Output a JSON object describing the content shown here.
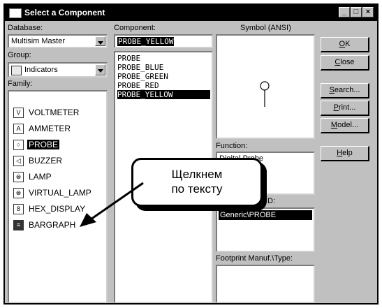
{
  "window": {
    "title": "Select a Component",
    "controls": [
      "_",
      "□",
      "×"
    ]
  },
  "database": {
    "label": "Database:",
    "value": "Multisim Master"
  },
  "group": {
    "label": "Group:",
    "value": "Indicators"
  },
  "family": {
    "label": "Family:",
    "items": [
      {
        "label": "VOLTMETER",
        "icon": "voltmeter-icon",
        "selected": false
      },
      {
        "label": "AMMETER",
        "icon": "ammeter-icon",
        "selected": false
      },
      {
        "label": "PROBE",
        "icon": "probe-icon",
        "selected": true
      },
      {
        "label": "BUZZER",
        "icon": "buzzer-icon",
        "selected": false
      },
      {
        "label": "LAMP",
        "icon": "lamp-icon",
        "selected": false
      },
      {
        "label": "VIRTUAL_LAMP",
        "icon": "virtual-lamp-icon",
        "selected": false
      },
      {
        "label": "HEX_DISPLAY",
        "icon": "hex-display-icon",
        "selected": false
      },
      {
        "label": "BARGRAPH",
        "icon": "bargraph-icon",
        "selected": false
      }
    ]
  },
  "component": {
    "label": "Component:",
    "value": "PROBE_YELLOW",
    "items": [
      {
        "label": "PROBE",
        "selected": false
      },
      {
        "label": "PROBE_BLUE",
        "selected": false
      },
      {
        "label": "PROBE_GREEN",
        "selected": false
      },
      {
        "label": "PROBE_RED",
        "selected": false
      },
      {
        "label": "PROBE_YELLOW",
        "selected": true
      }
    ]
  },
  "symbol": {
    "label": "Symbol (ANSI)"
  },
  "function": {
    "label": "Function:",
    "value": "Digital Probe"
  },
  "model_manuf": {
    "label_suffix": "D:",
    "value": "Generic\\PROBE"
  },
  "footprint": {
    "label": "Footprint Manuf.\\Type:"
  },
  "buttons": {
    "ok": {
      "mnemonic": "O",
      "rest": "K"
    },
    "close": {
      "mnemonic": "C",
      "rest": "lose"
    },
    "search": {
      "mnemonic": "S",
      "rest": "earch..."
    },
    "print": {
      "mnemonic": "P",
      "rest": "rint..."
    },
    "model": {
      "mnemonic": "M",
      "rest": "odel..."
    },
    "help": {
      "mnemonic": "H",
      "rest": "elp"
    }
  },
  "callout": {
    "line1": "Щелкнем",
    "line2": "по тексту"
  }
}
